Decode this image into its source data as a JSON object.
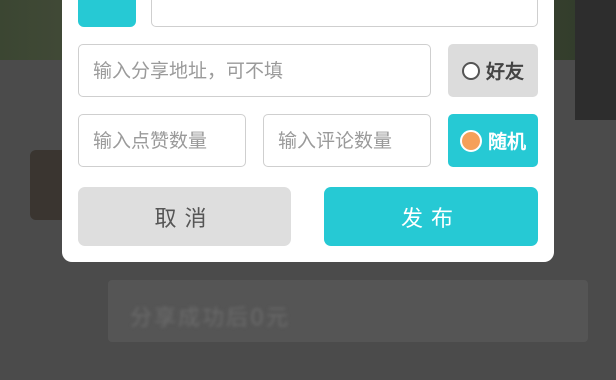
{
  "background": {
    "blurred_text": "分享成功后0元"
  },
  "form": {
    "share_placeholder": "输入分享地址，可不填",
    "likes_placeholder": "输入点赞数量",
    "comments_placeholder": "输入评论数量",
    "friends_label": "好友",
    "random_label": "随机",
    "friends_selected": false,
    "random_selected": true
  },
  "actions": {
    "cancel_label": "取消",
    "publish_label": "发布"
  },
  "colors": {
    "accent": "#26c9d4",
    "radio_selected": "#f5a05a",
    "cancel_bg": "#dedede"
  }
}
